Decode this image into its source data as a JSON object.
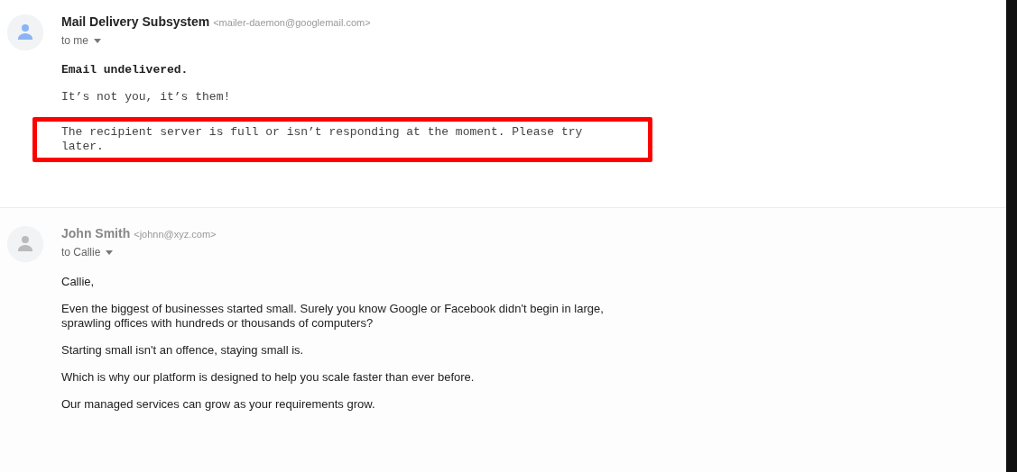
{
  "messages": [
    {
      "sender": "Mail Delivery Subsystem",
      "address": "<mailer-daemon@googlemail.com>",
      "sender_redacted": false,
      "recipient": "to me",
      "kind": "bounce",
      "paragraphs": [
        {
          "text": "Email undelivered.",
          "bold": true,
          "highlighted": false
        },
        {
          "text": "It’s not you, it’s them!",
          "bold": false,
          "highlighted": false
        },
        {
          "text": "The recipient server is full or isn’t responding at the moment. Please try later.",
          "bold": false,
          "highlighted": true
        }
      ]
    },
    {
      "sender": "John Smith",
      "address": "<johnn@xyz.com>",
      "sender_redacted": true,
      "recipient": "to Callie",
      "kind": "personal",
      "paragraphs": [
        {
          "text": "Callie,",
          "bold": false,
          "highlighted": false
        },
        {
          "text": "Even the biggest of businesses started small. Surely you know Google or Facebook didn't begin in large, sprawling offices with hundreds or thousands of computers?",
          "bold": false,
          "highlighted": false
        },
        {
          "text": "Starting small isn't an offence, staying small is.",
          "bold": false,
          "highlighted": false
        },
        {
          "text": "Which is why our platform is designed to help you scale faster than ever before.",
          "bold": false,
          "highlighted": false
        },
        {
          "text": "Our managed services can grow as your requirements grow.",
          "bold": false,
          "highlighted": false
        }
      ]
    }
  ]
}
